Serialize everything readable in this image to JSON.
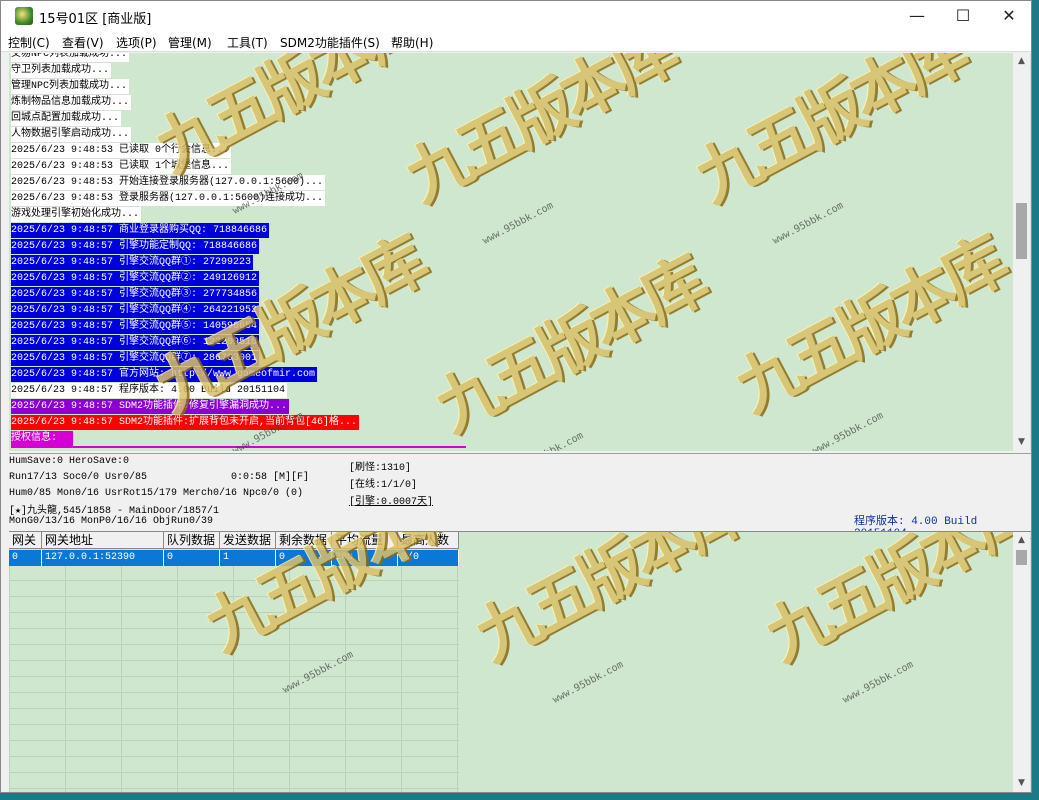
{
  "window": {
    "title": "15号01区 [商业版]",
    "controls": {
      "minimize": "—",
      "maximize": "☐",
      "close": "✕"
    }
  },
  "menu": [
    {
      "label": "控制(C)"
    },
    {
      "label": "查看(V)"
    },
    {
      "label": "选项(P)"
    },
    {
      "label": "管理(M)"
    },
    {
      "label": "工具(T)"
    },
    {
      "label": "SDM2功能插件(S)"
    },
    {
      "label": "帮助(H)"
    }
  ],
  "log": [
    {
      "text": "交易NPC列表加载成功...",
      "style": "white"
    },
    {
      "text": "守卫列表加载成功...",
      "style": "white"
    },
    {
      "text": "管理NPC列表加载成功...",
      "style": "white"
    },
    {
      "text": "炼制物品信息加载成功...",
      "style": "white"
    },
    {
      "text": "回城点配置加载成功...",
      "style": "white"
    },
    {
      "text": "人物数据引擎启动成功...",
      "style": "white"
    },
    {
      "text": "2025/6/23 9:48:53 已读取 0个行会信息...",
      "style": "white"
    },
    {
      "text": "2025/6/23 9:48:53 已读取 1个城堡信息...",
      "style": "white"
    },
    {
      "text": "2025/6/23 9:48:53 开始连接登录服务器(127.0.0.1:5600)...",
      "style": "white"
    },
    {
      "text": "2025/6/23 9:48:53 登录服务器(127.0.0.1:5600)连接成功...",
      "style": "white"
    },
    {
      "text": "游戏处理引擎初始化成功...",
      "style": "white"
    },
    {
      "text": "2025/6/23 9:48:57 商业登录器购买QQ: 718846686",
      "style": "blue"
    },
    {
      "text": "2025/6/23 9:48:57 引擎功能定制QQ: 718846686",
      "style": "blue"
    },
    {
      "text": "2025/6/23 9:48:57 引擎交流QQ群①: 27299223",
      "style": "blue"
    },
    {
      "text": "2025/6/23 9:48:57 引擎交流QQ群②: 249126912",
      "style": "blue"
    },
    {
      "text": "2025/6/23 9:48:57 引擎交流QQ群③: 277734856",
      "style": "blue"
    },
    {
      "text": "2025/6/23 9:48:57 引擎交流QQ群④: 264221952",
      "style": "blue"
    },
    {
      "text": "2025/6/23 9:48:57 引擎交流QQ群⑤: 140596654",
      "style": "blue"
    },
    {
      "text": "2025/6/23 9:48:57 引擎交流QQ群⑥: 122209510",
      "style": "blue"
    },
    {
      "text": "2025/6/23 9:48:57 引擎交流QQ群⑦: 286703001",
      "style": "blue"
    },
    {
      "text": "2025/6/23 9:48:57 官方网站: http://www.gameofmir.com",
      "style": "blue"
    },
    {
      "text": "2025/6/23 9:48:57 程序版本: 4.00 Build 20151104",
      "style": "white"
    },
    {
      "text": "2025/6/23 9:48:57 SDM2功能插件:修复引擎漏洞成功...",
      "style": "purple"
    },
    {
      "text": "2025/6/23 9:48:57 SDM2功能插件:扩展背包未开启,当前背包[46]格...",
      "style": "red"
    },
    {
      "text": "授权信息:",
      "style": "magenta"
    }
  ],
  "status": {
    "humsave": "HumSave:0 HeroSave:0",
    "run": "Run17/13 Soc0/0 Usr0/85",
    "uptime": "0:0:58 [M][F]",
    "hum": "Hum0/85 Mon0/16 UsrRot15/179 Merch0/16 Npc0/0 (0)",
    "player": "[★]九头龍,545/1858 - MainDoor/1857/1",
    "mongo": "MonG0/13/16 MonP0/16/16 ObjRun0/39",
    "refresh": "[刷怪:1310]",
    "online": "[在线:1/1/0]",
    "engine": "[引擎:0.0007天]",
    "version": "程序版本: 4.00 Build 20151104"
  },
  "gateway_table": {
    "columns": [
      "网关",
      "网关地址",
      "队列数据",
      "发送数据",
      "剩余数据",
      "平均流量",
      "最高人数"
    ],
    "rows": [
      [
        "0",
        "127.0.0.1:52390",
        "0",
        "1",
        "0",
        "20b",
        "0/0"
      ]
    ]
  },
  "watermark": {
    "text": "九五版本库",
    "url": "www.95bbk.com"
  }
}
